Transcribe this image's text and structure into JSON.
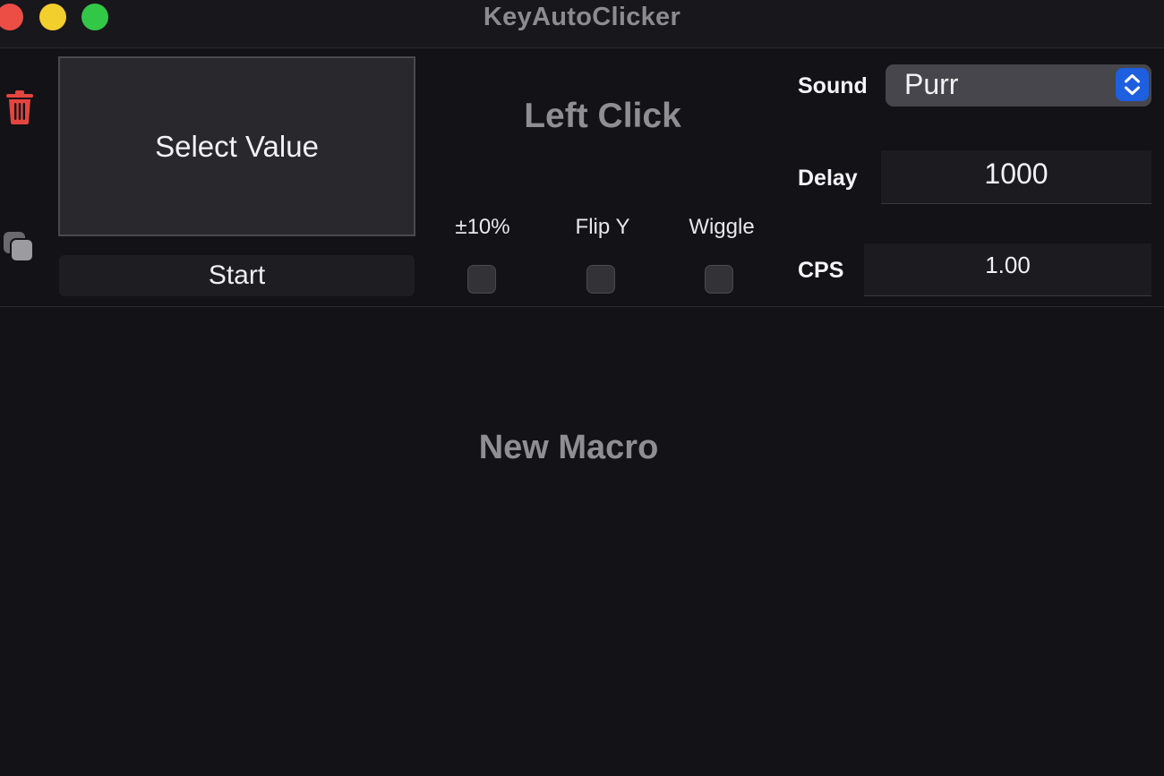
{
  "window": {
    "title": "KeyAutoClicker"
  },
  "panel": {
    "select_value_label": "Select Value",
    "start_label": "Start",
    "action_title": "Left Click",
    "options": {
      "randomize_label": "±10%",
      "flip_y_label": "Flip Y",
      "wiggle_label": "Wiggle"
    },
    "sound": {
      "label": "Sound",
      "value": "Purr"
    },
    "delay": {
      "label": "Delay",
      "value": "1000"
    },
    "cps": {
      "label": "CPS",
      "value": "1.00"
    }
  },
  "macro": {
    "placeholder": "New Macro"
  },
  "icons": {
    "trash": "trash-icon",
    "duplicate": "duplicate-icon",
    "stepper": "chevron-up-down-icon"
  },
  "colors": {
    "close": "#ec4d45",
    "minimize": "#f3cf2d",
    "maximize": "#33c747",
    "trash": "#e4453f",
    "accent": "#1e5fe0"
  }
}
